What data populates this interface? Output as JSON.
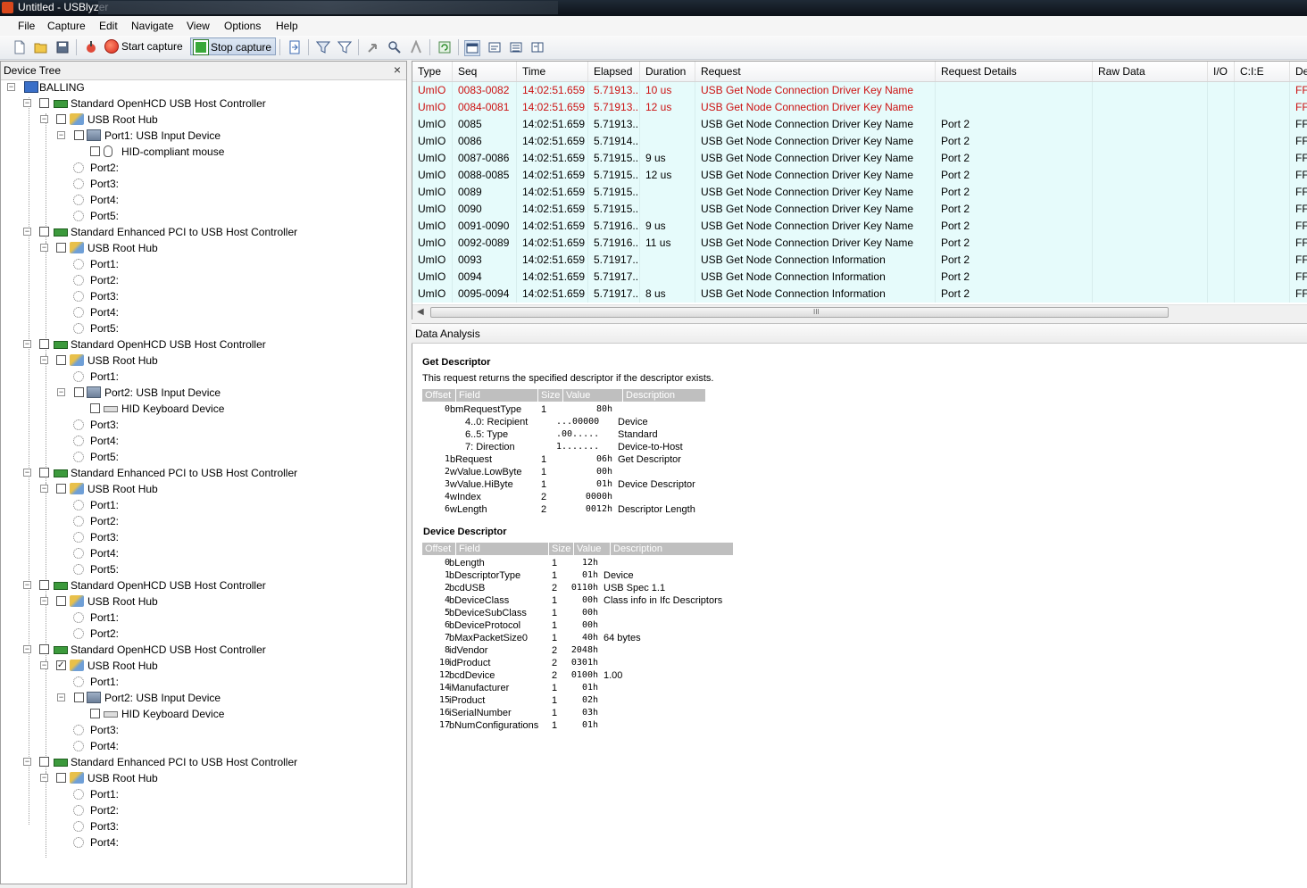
{
  "window": {
    "title": "Untitled - USBlyzer"
  },
  "menu": [
    "File",
    "Capture",
    "Edit",
    "Navigate",
    "View",
    "Options",
    "Help"
  ],
  "toolbar": {
    "start_capture": "Start capture",
    "stop_capture": "Stop capture"
  },
  "tree": {
    "title": "Device Tree",
    "close": "×",
    "nodes": [
      {
        "label": "BALLING",
        "level": 0,
        "icon": "computer-icon",
        "exp": "-",
        "chk": false
      },
      {
        "label": "Standard OpenHCD USB Host Controller",
        "level": 1,
        "icon": "controller-icon",
        "exp": "-",
        "chk": true
      },
      {
        "label": "USB Root Hub",
        "level": 2,
        "icon": "hub-icon",
        "exp": "-",
        "chk": true
      },
      {
        "label": "Port1: USB Input Device",
        "level": 3,
        "icon": "usb-device-icon",
        "exp": "-",
        "chk": true
      },
      {
        "label": "HID-compliant mouse",
        "level": 4,
        "icon": "mouse-icon",
        "exp": "",
        "chk": true
      },
      {
        "label": "Port2:",
        "level": 3,
        "icon": "port-icon",
        "exp": "",
        "chk": false
      },
      {
        "label": "Port3:",
        "level": 3,
        "icon": "port-icon",
        "exp": "",
        "chk": false
      },
      {
        "label": "Port4:",
        "level": 3,
        "icon": "port-icon",
        "exp": "",
        "chk": false
      },
      {
        "label": "Port5:",
        "level": 3,
        "icon": "port-icon",
        "exp": "",
        "chk": false
      },
      {
        "label": "Standard Enhanced PCI to USB Host Controller",
        "level": 1,
        "icon": "controller-icon",
        "exp": "-",
        "chk": true
      },
      {
        "label": "USB Root Hub",
        "level": 2,
        "icon": "hub-icon",
        "exp": "-",
        "chk": true
      },
      {
        "label": "Port1:",
        "level": 3,
        "icon": "port-icon",
        "exp": "",
        "chk": false
      },
      {
        "label": "Port2:",
        "level": 3,
        "icon": "port-icon",
        "exp": "",
        "chk": false
      },
      {
        "label": "Port3:",
        "level": 3,
        "icon": "port-icon",
        "exp": "",
        "chk": false
      },
      {
        "label": "Port4:",
        "level": 3,
        "icon": "port-icon",
        "exp": "",
        "chk": false
      },
      {
        "label": "Port5:",
        "level": 3,
        "icon": "port-icon",
        "exp": "",
        "chk": false
      },
      {
        "label": "Standard OpenHCD USB Host Controller",
        "level": 1,
        "icon": "controller-icon",
        "exp": "-",
        "chk": true
      },
      {
        "label": "USB Root Hub",
        "level": 2,
        "icon": "hub-icon",
        "exp": "-",
        "chk": true
      },
      {
        "label": "Port1:",
        "level": 3,
        "icon": "port-icon",
        "exp": "",
        "chk": false
      },
      {
        "label": "Port2: USB Input Device",
        "level": 3,
        "icon": "usb-device-icon",
        "exp": "-",
        "chk": true
      },
      {
        "label": "HID Keyboard Device",
        "level": 4,
        "icon": "keyboard-icon",
        "exp": "",
        "chk": true
      },
      {
        "label": "Port3:",
        "level": 3,
        "icon": "port-icon",
        "exp": "",
        "chk": false
      },
      {
        "label": "Port4:",
        "level": 3,
        "icon": "port-icon",
        "exp": "",
        "chk": false
      },
      {
        "label": "Port5:",
        "level": 3,
        "icon": "port-icon",
        "exp": "",
        "chk": false
      },
      {
        "label": "Standard Enhanced PCI to USB Host Controller",
        "level": 1,
        "icon": "controller-icon",
        "exp": "-",
        "chk": true
      },
      {
        "label": "USB Root Hub",
        "level": 2,
        "icon": "hub-icon",
        "exp": "-",
        "chk": true
      },
      {
        "label": "Port1:",
        "level": 3,
        "icon": "port-icon",
        "exp": "",
        "chk": false
      },
      {
        "label": "Port2:",
        "level": 3,
        "icon": "port-icon",
        "exp": "",
        "chk": false
      },
      {
        "label": "Port3:",
        "level": 3,
        "icon": "port-icon",
        "exp": "",
        "chk": false
      },
      {
        "label": "Port4:",
        "level": 3,
        "icon": "port-icon",
        "exp": "",
        "chk": false
      },
      {
        "label": "Port5:",
        "level": 3,
        "icon": "port-icon",
        "exp": "",
        "chk": false
      },
      {
        "label": "Standard OpenHCD USB Host Controller",
        "level": 1,
        "icon": "controller-icon",
        "exp": "-",
        "chk": true
      },
      {
        "label": "USB Root Hub",
        "level": 2,
        "icon": "hub-icon",
        "exp": "-",
        "chk": true
      },
      {
        "label": "Port1:",
        "level": 3,
        "icon": "port-icon",
        "exp": "",
        "chk": false
      },
      {
        "label": "Port2:",
        "level": 3,
        "icon": "port-icon",
        "exp": "",
        "chk": false
      },
      {
        "label": "Standard OpenHCD USB Host Controller",
        "level": 1,
        "icon": "controller-icon",
        "exp": "-",
        "chk": true
      },
      {
        "label": "USB Root Hub",
        "level": 2,
        "icon": "hub-icon",
        "exp": "-",
        "chk": true,
        "checked": true
      },
      {
        "label": "Port1:",
        "level": 3,
        "icon": "port-icon",
        "exp": "",
        "chk": false
      },
      {
        "label": "Port2: USB Input Device",
        "level": 3,
        "icon": "usb-device-icon",
        "exp": "-",
        "chk": true
      },
      {
        "label": "HID Keyboard Device",
        "level": 4,
        "icon": "keyboard-icon",
        "exp": "",
        "chk": true
      },
      {
        "label": "Port3:",
        "level": 3,
        "icon": "port-icon",
        "exp": "",
        "chk": false
      },
      {
        "label": "Port4:",
        "level": 3,
        "icon": "port-icon",
        "exp": "",
        "chk": false
      },
      {
        "label": "Standard Enhanced PCI to USB Host Controller",
        "level": 1,
        "icon": "controller-icon",
        "exp": "-",
        "chk": true
      },
      {
        "label": "USB Root Hub",
        "level": 2,
        "icon": "hub-icon",
        "exp": "-",
        "chk": true
      },
      {
        "label": "Port1:",
        "level": 3,
        "icon": "port-icon",
        "exp": "",
        "chk": false
      },
      {
        "label": "Port2:",
        "level": 3,
        "icon": "port-icon",
        "exp": "",
        "chk": false
      },
      {
        "label": "Port3:",
        "level": 3,
        "icon": "port-icon",
        "exp": "",
        "chk": false
      },
      {
        "label": "Port4:",
        "level": 3,
        "icon": "port-icon",
        "exp": "",
        "chk": false
      }
    ]
  },
  "grid": {
    "columns": [
      "Type",
      "Seq",
      "Time",
      "Elapsed",
      "Duration",
      "Request",
      "Request Details",
      "Raw Data",
      "I/O",
      "C:I:E",
      "De"
    ],
    "rows": [
      {
        "red": true,
        "cells": [
          "UmIO",
          "0083-0082",
          "14:02:51.659",
          "5.71913...",
          "10 us",
          "USB Get Node Connection Driver Key Name",
          "",
          "",
          "",
          "",
          "FFF"
        ]
      },
      {
        "red": true,
        "cells": [
          "UmIO",
          "0084-0081",
          "14:02:51.659",
          "5.71913...",
          "12 us",
          "USB Get Node Connection Driver Key Name",
          "",
          "",
          "",
          "",
          "FFF"
        ]
      },
      {
        "red": false,
        "cells": [
          "UmIO",
          "0085",
          "14:02:51.659",
          "5.71913...",
          "",
          "USB Get Node Connection Driver Key Name",
          "Port 2",
          "",
          "",
          "",
          "FFF"
        ]
      },
      {
        "red": false,
        "cells": [
          "UmIO",
          "0086",
          "14:02:51.659",
          "5.71914...",
          "",
          "USB Get Node Connection Driver Key Name",
          "Port 2",
          "",
          "",
          "",
          "FFF"
        ]
      },
      {
        "red": false,
        "cells": [
          "UmIO",
          "0087-0086",
          "14:02:51.659",
          "5.71915...",
          "9 us",
          "USB Get Node Connection Driver Key Name",
          "Port 2",
          "",
          "",
          "",
          "FFF"
        ]
      },
      {
        "red": false,
        "cells": [
          "UmIO",
          "0088-0085",
          "14:02:51.659",
          "5.71915...",
          "12 us",
          "USB Get Node Connection Driver Key Name",
          "Port 2",
          "",
          "",
          "",
          "FFF"
        ]
      },
      {
        "red": false,
        "cells": [
          "UmIO",
          "0089",
          "14:02:51.659",
          "5.71915...",
          "",
          "USB Get Node Connection Driver Key Name",
          "Port 2",
          "",
          "",
          "",
          "FFF"
        ]
      },
      {
        "red": false,
        "cells": [
          "UmIO",
          "0090",
          "14:02:51.659",
          "5.71915...",
          "",
          "USB Get Node Connection Driver Key Name",
          "Port 2",
          "",
          "",
          "",
          "FFF"
        ]
      },
      {
        "red": false,
        "cells": [
          "UmIO",
          "0091-0090",
          "14:02:51.659",
          "5.71916...",
          "9 us",
          "USB Get Node Connection Driver Key Name",
          "Port 2",
          "",
          "",
          "",
          "FFF"
        ]
      },
      {
        "red": false,
        "cells": [
          "UmIO",
          "0092-0089",
          "14:02:51.659",
          "5.71916...",
          "11 us",
          "USB Get Node Connection Driver Key Name",
          "Port 2",
          "",
          "",
          "",
          "FFF"
        ]
      },
      {
        "red": false,
        "cells": [
          "UmIO",
          "0093",
          "14:02:51.659",
          "5.71917...",
          "",
          "USB Get Node Connection Information",
          "Port 2",
          "",
          "",
          "",
          "FFF"
        ]
      },
      {
        "red": false,
        "cells": [
          "UmIO",
          "0094",
          "14:02:51.659",
          "5.71917...",
          "",
          "USB Get Node Connection Information",
          "Port 2",
          "",
          "",
          "",
          "FFF"
        ]
      },
      {
        "red": false,
        "cells": [
          "UmIO",
          "0095-0094",
          "14:02:51.659",
          "5.71917...",
          "8 us",
          "USB Get Node Connection Information",
          "Port 2",
          "",
          "",
          "",
          "FFF"
        ]
      }
    ],
    "scroll_grip": "III"
  },
  "analysis": {
    "title": "Data Analysis",
    "get_descriptor": {
      "title": "Get Descriptor",
      "description": "This request returns the specified descriptor if the descriptor exists.",
      "headers": [
        "Offset",
        "Field",
        "Size",
        "Value",
        "Description"
      ],
      "rows": [
        {
          "offset": "0",
          "field": "bmRequestType",
          "size": "1",
          "value": "80h",
          "desc": ""
        },
        {
          "offset": "",
          "field": "4..0: Recipient",
          "size": "",
          "value": "...00000",
          "desc": "Device"
        },
        {
          "offset": "",
          "field": "6..5: Type",
          "size": "",
          "value": ".00.....",
          "desc": "Standard"
        },
        {
          "offset": "",
          "field": "7: Direction",
          "size": "",
          "value": "1.......",
          "desc": "Device-to-Host"
        },
        {
          "offset": "1",
          "field": "bRequest",
          "size": "1",
          "value": "06h",
          "desc": "Get Descriptor"
        },
        {
          "offset": "2",
          "field": "wValue.LowByte",
          "size": "1",
          "value": "00h",
          "desc": ""
        },
        {
          "offset": "3",
          "field": "wValue.HiByte",
          "size": "1",
          "value": "01h",
          "desc": "Device Descriptor"
        },
        {
          "offset": "4",
          "field": "wIndex",
          "size": "2",
          "value": "0000h",
          "desc": ""
        },
        {
          "offset": "6",
          "field": "wLength",
          "size": "2",
          "value": "0012h",
          "desc": "Descriptor Length"
        }
      ]
    },
    "device_descriptor": {
      "title": "Device Descriptor",
      "headers": [
        "Offset",
        "Field",
        "Size",
        "Value",
        "Description"
      ],
      "rows": [
        {
          "offset": "0",
          "field": "bLength",
          "size": "1",
          "value": "12h",
          "desc": ""
        },
        {
          "offset": "1",
          "field": "bDescriptorType",
          "size": "1",
          "value": "01h",
          "desc": "Device"
        },
        {
          "offset": "2",
          "field": "bcdUSB",
          "size": "2",
          "value": "0110h",
          "desc": "USB Spec 1.1"
        },
        {
          "offset": "4",
          "field": "bDeviceClass",
          "size": "1",
          "value": "00h",
          "desc": "Class info in Ifc Descriptors"
        },
        {
          "offset": "5",
          "field": "bDeviceSubClass",
          "size": "1",
          "value": "00h",
          "desc": ""
        },
        {
          "offset": "6",
          "field": "bDeviceProtocol",
          "size": "1",
          "value": "00h",
          "desc": ""
        },
        {
          "offset": "7",
          "field": "bMaxPacketSize0",
          "size": "1",
          "value": "40h",
          "desc": "64 bytes"
        },
        {
          "offset": "8",
          "field": "idVendor",
          "size": "2",
          "value": "2048h",
          "desc": ""
        },
        {
          "offset": "10",
          "field": "idProduct",
          "size": "2",
          "value": "0301h",
          "desc": ""
        },
        {
          "offset": "12",
          "field": "bcdDevice",
          "size": "2",
          "value": "0100h",
          "desc": "1.00"
        },
        {
          "offset": "14",
          "field": "iManufacturer",
          "size": "1",
          "value": "01h",
          "desc": ""
        },
        {
          "offset": "15",
          "field": "iProduct",
          "size": "1",
          "value": "02h",
          "desc": ""
        },
        {
          "offset": "16",
          "field": "iSerialNumber",
          "size": "1",
          "value": "03h",
          "desc": ""
        },
        {
          "offset": "17",
          "field": "bNumConfigurations",
          "size": "1",
          "value": "01h",
          "desc": ""
        }
      ]
    }
  }
}
